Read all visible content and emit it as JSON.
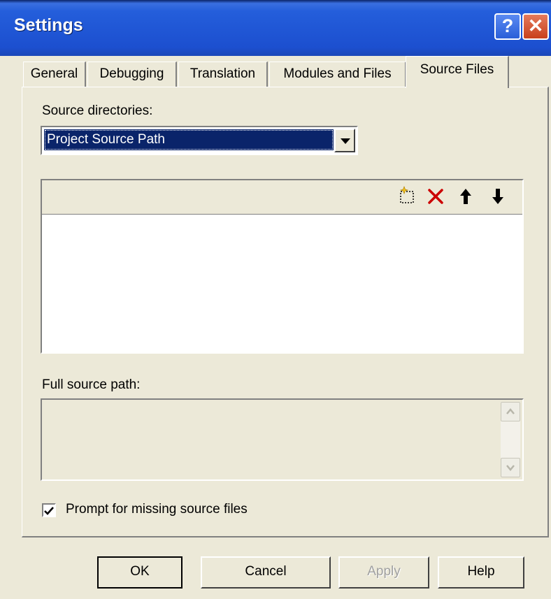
{
  "window": {
    "title": "Settings",
    "help_glyph": "?",
    "close_glyph": "✕"
  },
  "tabs": [
    {
      "label": "General",
      "active": false
    },
    {
      "label": "Debugging",
      "active": false
    },
    {
      "label": "Translation",
      "active": false
    },
    {
      "label": "Modules and Files",
      "active": false
    },
    {
      "label": "Source Files",
      "active": true
    }
  ],
  "source_directories": {
    "label": "Source directories:",
    "selected": "Project Source Path"
  },
  "list_toolbar": {
    "icons": [
      "new-folder-icon",
      "delete-icon",
      "move-up-icon",
      "move-down-icon"
    ]
  },
  "full_source_path": {
    "label": "Full source path:",
    "value": ""
  },
  "prompt_missing": {
    "label": "Prompt for missing source files",
    "checked": true
  },
  "buttons": {
    "ok": "OK",
    "cancel": "Cancel",
    "apply": "Apply",
    "help": "Help"
  },
  "colors": {
    "titlebar": "#245edb",
    "dialog_bg": "#ece9d8",
    "selection": "#0a246a",
    "delete_icon": "#cc0000"
  }
}
